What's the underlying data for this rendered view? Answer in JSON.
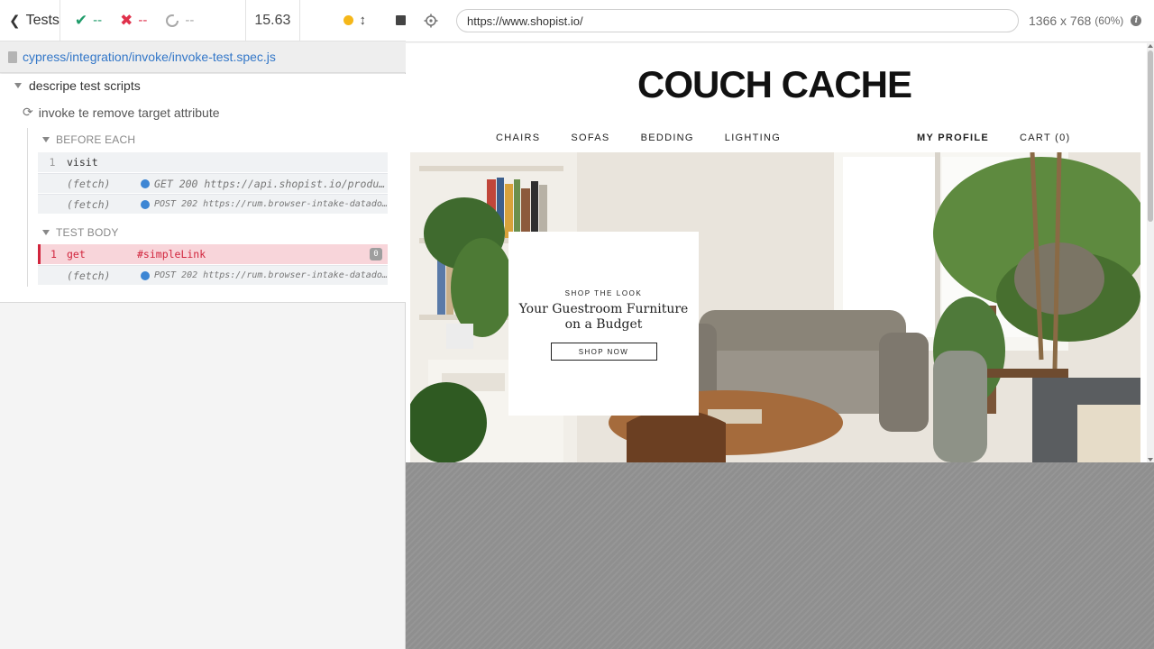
{
  "reporter": {
    "back_label": "Tests",
    "passed": "--",
    "failed": "--",
    "pending": "--",
    "duration": "15.63",
    "spec_path": "cypress/integration/invoke/invoke-test.spec.js",
    "suite_title": "descripe test scripts",
    "test_title": "invoke te remove target attribute",
    "hooks": {
      "before_each": "BEFORE EACH",
      "test_body": "TEST BODY"
    },
    "commands": {
      "visit": {
        "num": "1",
        "name": "visit",
        "message": ""
      },
      "fetch1": {
        "name": "(fetch)",
        "message": "GET 200 https://api.shopist.io/produc…"
      },
      "fetch2": {
        "name": "(fetch)",
        "message": "POST 202 https://rum.browser-intake-datadogh…"
      },
      "get": {
        "num": "1",
        "name": "get",
        "message": "#simpleLink",
        "badge": "0"
      },
      "fetch3": {
        "name": "(fetch)",
        "message": "POST 202 https://rum.browser-intake-datadogh…"
      }
    },
    "colors": {
      "pass": "#1f9c6a",
      "fail": "#e0314b",
      "link": "#3377c8",
      "running": "#f5b719"
    }
  },
  "aut": {
    "url": "https://www.shopist.io/",
    "viewport": "1366 x 768",
    "scale": "(60%)"
  },
  "site": {
    "logo": "COUCH CACHE",
    "nav_left": [
      "CHAIRS",
      "SOFAS",
      "BEDDING",
      "LIGHTING"
    ],
    "nav_right": {
      "profile": "MY PROFILE",
      "cart": "CART (0)"
    },
    "promo": {
      "kicker": "SHOP THE LOOK",
      "headline": "Your Guestroom Furniture on a Budget",
      "button": "SHOP NOW"
    }
  }
}
